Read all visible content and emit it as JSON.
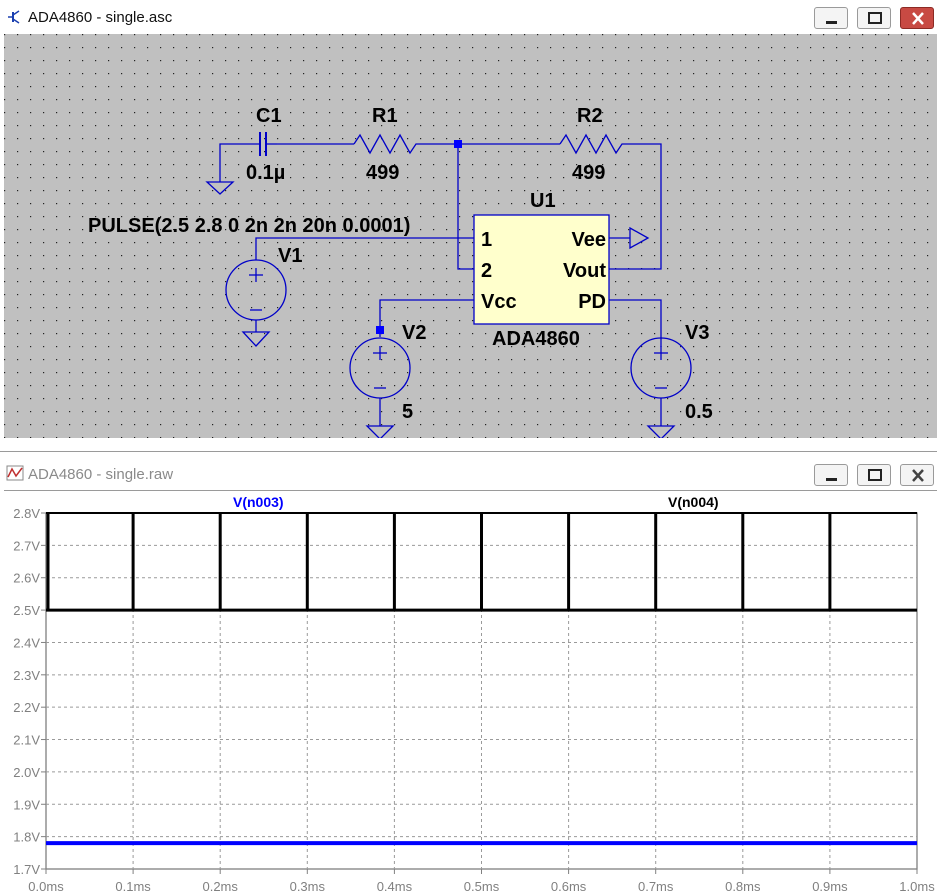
{
  "schematic_window": {
    "title": "ADA4860 - single.asc",
    "icon": "transistor-icon"
  },
  "waveform_window": {
    "title": "ADA4860 - single.raw",
    "icon": "waveform-icon"
  },
  "window_buttons": {
    "minimize": "minimize-icon",
    "maximize": "maximize-icon",
    "close": "close-icon"
  },
  "schematic": {
    "components": {
      "c1": {
        "name": "C1",
        "value": "0.1µ"
      },
      "r1": {
        "name": "R1",
        "value": "499"
      },
      "r2": {
        "name": "R2",
        "value": "499"
      },
      "u1": {
        "name": "U1",
        "part": "ADA4860",
        "pins": {
          "p1": "1",
          "p2": "2",
          "vcc": "Vcc",
          "vee": "Vee",
          "vout": "Vout",
          "pd": "PD"
        }
      },
      "v1": {
        "name": "V1",
        "value": "PULSE(2.5 2.8 0 2n 2n 20n 0.0001)"
      },
      "v2": {
        "name": "V2",
        "value": "5"
      },
      "v3": {
        "name": "V3",
        "value": "0.5"
      }
    },
    "colors": {
      "background": "#c0c0c0",
      "wire": "#0000c8",
      "component": "#0000c8",
      "ic_fill": "#ffffcc"
    }
  },
  "chart_data": {
    "type": "line",
    "x_ticks": [
      "0.0ms",
      "0.1ms",
      "0.2ms",
      "0.3ms",
      "0.4ms",
      "0.5ms",
      "0.6ms",
      "0.7ms",
      "0.8ms",
      "0.9ms",
      "1.0ms"
    ],
    "y_ticks": [
      "1.7V",
      "1.8V",
      "1.9V",
      "2.0V",
      "2.1V",
      "2.2V",
      "2.3V",
      "2.4V",
      "2.5V",
      "2.6V",
      "2.7V",
      "2.8V"
    ],
    "xlim": [
      0,
      1.0
    ],
    "ylim": [
      1.7,
      2.8
    ],
    "grid": true,
    "series": [
      {
        "name": "V(n003)",
        "color": "#0000ff",
        "kind": "constant",
        "level": 1.78
      },
      {
        "name": "V(n004)",
        "color": "#000000",
        "kind": "pulse",
        "low": 2.5,
        "high": 2.8,
        "pulse_times": [
          0.0,
          0.1,
          0.2,
          0.3,
          0.4,
          0.5,
          0.6,
          0.7,
          0.8,
          0.9
        ]
      }
    ]
  }
}
